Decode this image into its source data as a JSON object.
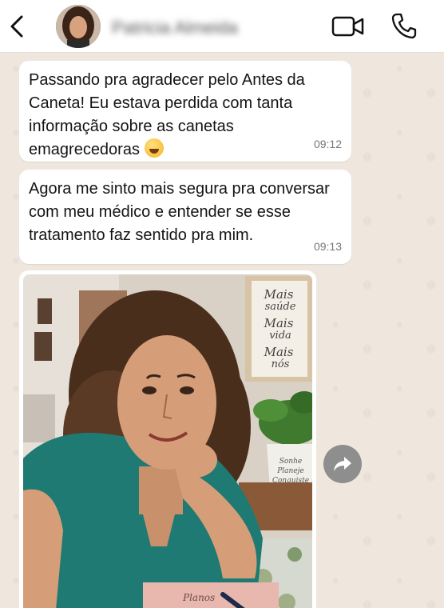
{
  "header": {
    "contact_name": "Patricia Almeida",
    "icons": {
      "back": "chevron-left-icon",
      "video": "video-call-icon",
      "call": "phone-icon"
    }
  },
  "messages": [
    {
      "text": "Passando pra agradecer pelo Antes da Caneta! Eu estava perdida com tanta informação sobre as canetas emagrecedoras",
      "emoji": "sweat-smile-emoji",
      "time": "09:12"
    },
    {
      "text": "Agora me sinto mais segura pra conversar com meu médico e entender se esse tratamento faz sentido pra mim.",
      "time": "09:13"
    }
  ],
  "photo": {
    "sign_lines": [
      "Mais",
      "saúde",
      "Mais",
      "vida",
      "Mais",
      "nós"
    ],
    "pot_text": [
      "Sonhe",
      "Planeje",
      "Conquiste"
    ],
    "notebook_text": "Planos"
  },
  "colors": {
    "chat_bg": "#efe7de",
    "bubble_bg": "#ffffff",
    "forward_btn": "#8e8e8e"
  }
}
